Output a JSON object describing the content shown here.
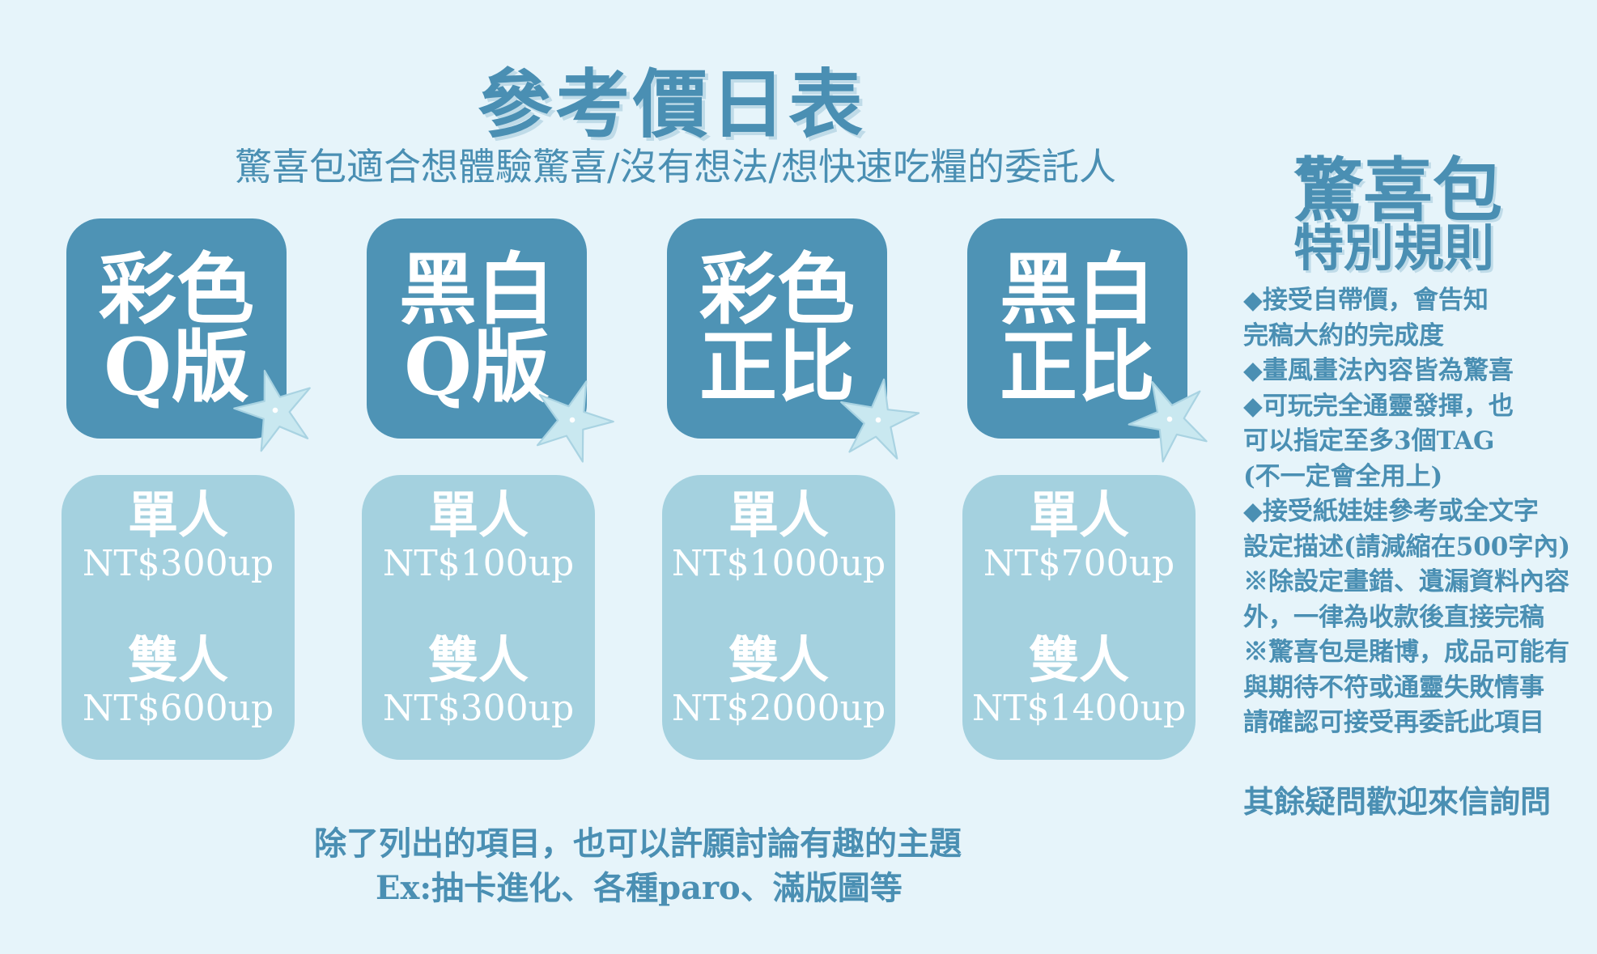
{
  "title": "參考價日表",
  "subtitle": "驚喜包適合想體驗驚喜/沒有想法/想快速吃糧的委託人",
  "packages": [
    {
      "line1": "彩色",
      "line2": "Q版",
      "single_label": "單人",
      "single_price": "NT$300up",
      "double_label": "雙人",
      "double_price": "NT$600up"
    },
    {
      "line1": "黑白",
      "line2": "Q版",
      "single_label": "單人",
      "single_price": "NT$100up",
      "double_label": "雙人",
      "double_price": "NT$300up"
    },
    {
      "line1": "彩色",
      "line2": "正比",
      "single_label": "單人",
      "single_price": "NT$1000up",
      "double_label": "雙人",
      "double_price": "NT$2000up"
    },
    {
      "line1": "黑白",
      "line2": "正比",
      "single_label": "單人",
      "single_price": "NT$700up",
      "double_label": "雙人",
      "double_price": "NT$1400up"
    }
  ],
  "side": {
    "title": "驚喜包",
    "subtitle": "特別規則",
    "rules": [
      "◆接受自帶價，會告知",
      "完稿大約的完成度",
      "◆畫風畫法內容皆為驚喜",
      "◆可玩完全通靈發揮，也",
      "可以指定至多3個TAG",
      "(不一定會全用上)",
      "◆接受紙娃娃參考或全文字",
      "設定描述(請減縮在500字內)",
      "※除設定畫錯、遺漏資料內容",
      "外，一律為收款後直接完稿",
      "※驚喜包是賭博，成品可能有",
      "與期待不符或通靈失敗情事",
      "請確認可接受再委託此項目"
    ],
    "closing": "其餘疑問歡迎來信詢問"
  },
  "footer": {
    "line1": "除了列出的項目，也可以許願討論有趣的主題",
    "line2": "Ex:抽卡進化、各種paro、滿版圖等"
  },
  "colors": {
    "background": "#e6f4fa",
    "accent": "#4a8fb3",
    "dark_box": "#4e93b5",
    "light_box": "#a4d1df",
    "starfish": "#c9e8f0"
  },
  "decorations": [
    "starfish-icon"
  ]
}
